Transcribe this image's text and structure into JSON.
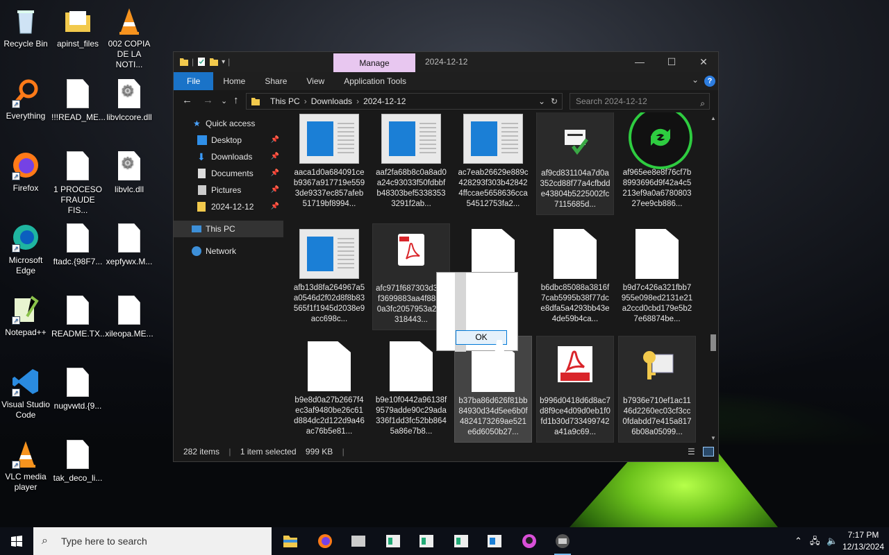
{
  "desktop": {
    "icons": [
      {
        "label": "Recycle Bin",
        "type": "recycle-bin"
      },
      {
        "label": "apinst_files",
        "type": "folder"
      },
      {
        "label": "002 COPIA DE LA NOTI...",
        "type": "vlc"
      },
      {
        "label": "Everything",
        "type": "everything"
      },
      {
        "label": "!!!READ_ME...",
        "type": "file"
      },
      {
        "label": "libvlccore.dll",
        "type": "dll"
      },
      {
        "label": "Firefox",
        "type": "firefox"
      },
      {
        "label": "1 PROCESO FRAUDE FIS...",
        "type": "file"
      },
      {
        "label": "libvlc.dll",
        "type": "dll"
      },
      {
        "label": "Microsoft Edge",
        "type": "edge"
      },
      {
        "label": "ftadc.{98F7...",
        "type": "file"
      },
      {
        "label": "xepfywx.M...",
        "type": "file"
      },
      {
        "label": "Notepad++",
        "type": "notepad"
      },
      {
        "label": "README.TX...",
        "type": "file"
      },
      {
        "label": "xileopa.ME...",
        "type": "file"
      },
      {
        "label": "Visual Studio Code",
        "type": "vscode"
      },
      {
        "label": "nugvwtd.{9...",
        "type": "file"
      },
      {
        "label": "VLC media player",
        "type": "vlc"
      },
      {
        "label": "tak_deco_li...",
        "type": "file"
      }
    ]
  },
  "window": {
    "context_tab": "Manage",
    "title": "2024-12-12",
    "ribbon_tabs": [
      "File",
      "Home",
      "Share",
      "View",
      "Application Tools"
    ],
    "address": {
      "crumbs": [
        "This PC",
        "Downloads",
        "2024-12-12"
      ]
    },
    "search_placeholder": "Search 2024-12-12",
    "nav": {
      "quick_access": "Quick access",
      "items": [
        "Desktop",
        "Downloads",
        "Documents",
        "Pictures",
        "2024-12-12"
      ],
      "this_pc": "This PC",
      "network": "Network"
    },
    "files": [
      {
        "label": "aaca1d0a684091ceb9367a917719e5593de9337ec857afeb51719bf8994...",
        "kind": "image"
      },
      {
        "label": "aaf2fa68b8c0a8ad0a24c93033f50fdbbfb48303bef53383533291f2ab...",
        "kind": "image"
      },
      {
        "label": "ac7eab26629e889c428293f303b428424ffccae5658636cca54512753fa2...",
        "kind": "image"
      },
      {
        "label": "af9cd831104a7d0a352cd88f77a4cfbdde43804b5225002fc7115685d...",
        "kind": "check"
      },
      {
        "label": "af965ee8e8f76cf7b8993696d9f42a4c5213ef9a0a678080327ee9cb886...",
        "kind": "green-sync"
      },
      {
        "label": "afb13d8fa264967a5a0546d2f02d8f8b83565f1f1945d2038e9acc698c...",
        "kind": "image"
      },
      {
        "label": "afc971f687303d3b3f3699883aa4f885d0a3fc2057953a28d318443...",
        "kind": "pdf-thumb"
      },
      {
        "label": "b1c...ae...d6...",
        "kind": "blank"
      },
      {
        "label": "b6dbc85088a3816f7cab5995b38f77dce8dfa5a4293bb43e4de59b4ca...",
        "kind": "blank"
      },
      {
        "label": "b9d7c426a321fbb7955e098ed2131e21a2ccd0cbd179e5b27e68874be...",
        "kind": "blank"
      },
      {
        "label": "b9e8d0a27b2667f4ec3af9480be26c61d884dc2d122d9a46ac76b5e81...",
        "kind": "blank"
      },
      {
        "label": "b9e10f0442a96138f9579adde90c29ada336f1dd3fc52bb8645a86e7b8...",
        "kind": "blank"
      },
      {
        "label": "b37ba86d626f81bb84930d34d5ee6b0f4824173269ae521e6d6050b27...",
        "kind": "blank"
      },
      {
        "label": "b996d0418d6d8ac7d8f9ce4d09d0eb1f0fd1b30d733499742a41a9c69...",
        "kind": "pdf"
      },
      {
        "label": "b7936e710ef1ac1146d2260ec03cf3cc0fdabdd7e415a8176b08a05099...",
        "kind": "key"
      }
    ],
    "status": {
      "count": "282 items",
      "selection": "1 item selected",
      "size": "999 KB"
    }
  },
  "dialog": {
    "ok_label": "OK"
  },
  "taskbar": {
    "search_placeholder": "Type here to search",
    "time": "7:17 PM",
    "date": "12/13/2024"
  },
  "colors": {
    "file_tab": "#1a73c8",
    "manage_tab": "#e8c7f0",
    "accent": "#0078d7"
  }
}
